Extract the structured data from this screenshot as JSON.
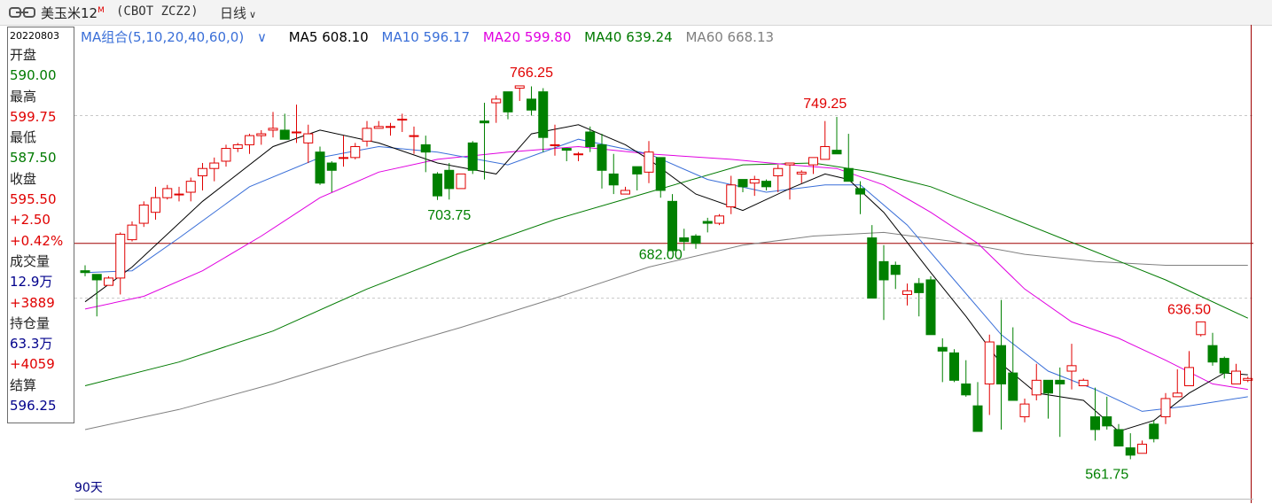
{
  "header": {
    "instrument_name": "美玉米12",
    "main_contract_mark": "M",
    "code": "(CBOT ZCZ2)",
    "period": "日线"
  },
  "info_panel": {
    "date": "20220803",
    "open_label": "开盘",
    "open": "590.00",
    "high_label": "最高",
    "high": "599.75",
    "low_label": "最低",
    "low": "587.50",
    "close_label": "收盘",
    "close": "595.50",
    "change": "+2.50",
    "change_pct": "+0.42%",
    "volume_label": "成交量",
    "volume": "12.9万",
    "volume_change": "+3889",
    "oi_label": "持仓量",
    "oi": "63.3万",
    "oi_change": "+4059",
    "settle_label": "结算",
    "settle": "596.25"
  },
  "legend": {
    "combo": "MA组合(5,10,20,40,60,0)",
    "ma5": "MA5 608.10",
    "ma10": "MA10 596.17",
    "ma20": "MA20 599.80",
    "ma40": "MA40 639.24",
    "ma60": "MA60 668.13"
  },
  "footer": {
    "days": "90天"
  },
  "colors": {
    "up": "#e00000",
    "down": "#008000",
    "ma5": "#000000",
    "ma10": "#3a6fd8",
    "ma20": "#e000e0",
    "ma40": "#007a00",
    "ma60": "#808080",
    "crosshair": "#a00000"
  },
  "chart_data": {
    "type": "candlestick",
    "ylim": [
      545,
      790
    ],
    "crosshair_price": 680,
    "annotations": [
      {
        "label": "766.25",
        "candle": 38,
        "price": 766.25,
        "kind": "high"
      },
      {
        "label": "703.75",
        "candle": 31,
        "price": 703.75,
        "kind": "low"
      },
      {
        "label": "749.25",
        "candle": 63,
        "price": 749.25,
        "kind": "high"
      },
      {
        "label": "682.00",
        "candle": 49,
        "price": 682.0,
        "kind": "low"
      },
      {
        "label": "561.75",
        "candle": 87,
        "price": 561.75,
        "kind": "low"
      },
      {
        "label": "636.50",
        "candle": 94,
        "price": 636.5,
        "kind": "high"
      }
    ],
    "candles": [
      [
        665,
        664,
        668,
        662
      ],
      [
        663,
        660,
        662,
        640
      ],
      [
        657,
        661,
        662,
        657
      ],
      [
        661,
        685,
        686,
        652
      ],
      [
        682,
        690,
        692,
        681
      ],
      [
        691,
        701,
        703,
        689
      ],
      [
        697,
        705,
        711,
        693
      ],
      [
        705,
        710,
        712,
        704
      ],
      [
        707,
        707,
        711,
        703
      ],
      [
        708,
        714,
        716,
        703
      ],
      [
        717,
        721,
        724,
        709
      ],
      [
        721,
        724,
        727,
        714
      ],
      [
        725,
        732,
        734,
        722
      ],
      [
        732,
        734,
        735,
        730
      ],
      [
        734,
        739,
        740,
        729
      ],
      [
        739,
        740,
        742,
        734
      ],
      [
        742,
        743,
        752,
        738
      ],
      [
        742,
        737,
        751,
        737
      ],
      [
        741,
        741,
        756,
        735
      ],
      [
        735,
        740,
        745,
        724
      ],
      [
        730,
        713,
        733,
        712
      ],
      [
        724,
        720,
        725,
        708
      ],
      [
        727,
        727,
        739,
        722
      ],
      [
        727,
        733,
        735,
        726
      ],
      [
        736,
        743,
        747,
        733
      ],
      [
        743,
        744,
        747,
        743
      ],
      [
        744,
        744,
        746,
        739
      ],
      [
        748,
        748,
        751,
        741
      ],
      [
        739,
        739,
        744,
        729
      ],
      [
        734,
        730,
        739,
        719
      ],
      [
        718,
        706,
        719,
        703.75
      ],
      [
        720,
        710,
        724,
        704
      ],
      [
        710,
        718,
        718,
        710
      ],
      [
        735,
        720,
        736,
        718
      ],
      [
        747,
        746,
        757,
        715
      ],
      [
        757,
        759,
        761,
        746
      ],
      [
        763,
        752,
        763,
        748
      ],
      [
        765,
        766.25,
        766.25,
        758
      ],
      [
        759,
        753,
        766,
        750
      ],
      [
        763,
        738,
        765,
        730
      ],
      [
        734,
        734,
        745,
        728
      ],
      [
        732,
        731,
        732,
        725
      ],
      [
        729,
        729,
        730,
        725
      ],
      [
        741,
        733,
        744,
        730
      ],
      [
        734,
        720,
        740,
        710
      ],
      [
        718,
        712,
        729,
        707
      ],
      [
        707,
        709,
        711,
        707
      ],
      [
        722,
        718,
        722,
        709
      ],
      [
        719,
        730,
        736,
        713
      ],
      [
        727,
        709,
        727,
        705
      ],
      [
        703,
        676,
        707,
        682
      ],
      [
        683,
        681,
        688,
        676
      ],
      [
        684,
        680,
        685,
        677
      ],
      [
        692,
        691,
        694,
        686
      ],
      [
        691,
        695,
        696,
        690
      ],
      [
        700,
        712,
        717,
        696
      ],
      [
        715,
        711,
        714,
        708
      ],
      [
        713,
        715,
        717,
        706
      ],
      [
        714,
        711,
        715,
        709
      ],
      [
        717,
        721,
        723,
        708
      ],
      [
        723,
        724,
        724,
        704
      ],
      [
        718,
        719,
        720,
        713
      ],
      [
        723,
        727,
        727,
        718
      ],
      [
        726,
        733,
        747,
        733
      ],
      [
        731,
        729,
        749.25,
        729
      ],
      [
        721,
        714,
        740,
        719
      ],
      [
        710,
        707,
        714,
        696
      ],
      [
        683,
        650,
        690,
        655
      ],
      [
        670,
        660,
        679,
        638
      ],
      [
        668,
        663,
        670,
        655
      ],
      [
        652,
        654,
        658,
        646
      ],
      [
        658,
        653,
        661,
        640
      ],
      [
        660,
        630,
        662,
        630
      ],
      [
        623,
        621,
        628,
        604
      ],
      [
        620,
        605,
        622,
        604
      ],
      [
        603,
        597,
        616,
        596
      ],
      [
        591,
        577,
        604,
        577
      ],
      [
        603,
        626,
        630,
        586
      ],
      [
        624,
        603,
        649,
        578
      ],
      [
        609,
        594,
        634,
        595
      ],
      [
        585,
        592,
        595,
        582
      ],
      [
        597,
        605,
        614,
        594
      ],
      [
        605,
        598,
        605,
        584
      ],
      [
        605,
        603,
        612,
        574
      ],
      [
        610,
        613,
        625,
        600
      ],
      [
        602,
        605,
        606,
        604
      ],
      [
        585,
        578,
        601,
        572
      ],
      [
        585,
        580,
        596,
        578
      ],
      [
        578,
        569,
        581,
        570
      ],
      [
        568,
        564,
        576,
        561.75
      ],
      [
        565,
        570,
        572,
        566
      ],
      [
        581,
        573,
        583,
        571
      ],
      [
        585,
        595,
        598,
        581
      ],
      [
        596,
        598,
        611,
        597
      ],
      [
        602,
        612,
        621,
        602
      ],
      [
        630,
        637,
        636.5,
        629
      ],
      [
        624,
        615,
        631,
        613
      ],
      [
        617,
        609,
        618,
        606
      ],
      [
        603,
        610,
        614,
        603
      ],
      [
        605,
        606,
        607,
        604
      ]
    ],
    "ma5": [
      [
        0,
        648
      ],
      [
        4,
        667
      ],
      [
        10,
        703
      ],
      [
        16,
        733
      ],
      [
        20,
        742
      ],
      [
        25,
        735
      ],
      [
        30,
        724
      ],
      [
        35,
        718
      ],
      [
        38,
        740
      ],
      [
        42,
        745
      ],
      [
        46,
        734
      ],
      [
        48,
        726
      ],
      [
        52,
        707
      ],
      [
        56,
        698
      ],
      [
        60,
        710
      ],
      [
        63,
        718
      ],
      [
        65,
        715
      ],
      [
        68,
        697
      ],
      [
        72,
        664
      ],
      [
        75,
        640
      ],
      [
        78,
        614
      ],
      [
        81,
        598
      ],
      [
        85,
        594
      ],
      [
        88,
        577
      ],
      [
        91,
        583
      ],
      [
        94,
        598
      ],
      [
        97,
        609
      ],
      [
        99,
        608
      ]
    ],
    "ma10": [
      [
        0,
        664
      ],
      [
        4,
        665
      ],
      [
        8,
        683
      ],
      [
        14,
        711
      ],
      [
        20,
        727
      ],
      [
        25,
        733
      ],
      [
        30,
        730
      ],
      [
        36,
        723
      ],
      [
        42,
        737
      ],
      [
        48,
        729
      ],
      [
        53,
        715
      ],
      [
        58,
        708
      ],
      [
        63,
        712
      ],
      [
        66,
        712
      ],
      [
        70,
        690
      ],
      [
        74,
        660
      ],
      [
        78,
        630
      ],
      [
        82,
        610
      ],
      [
        86,
        600
      ],
      [
        90,
        588
      ],
      [
        94,
        591
      ],
      [
        99,
        596
      ]
    ],
    "ma20": [
      [
        0,
        644
      ],
      [
        5,
        651
      ],
      [
        10,
        665
      ],
      [
        15,
        684
      ],
      [
        20,
        705
      ],
      [
        25,
        719
      ],
      [
        30,
        726
      ],
      [
        36,
        730
      ],
      [
        42,
        733
      ],
      [
        48,
        729
      ],
      [
        55,
        726
      ],
      [
        60,
        723
      ],
      [
        64,
        721
      ],
      [
        68,
        712
      ],
      [
        72,
        697
      ],
      [
        76,
        680
      ],
      [
        80,
        655
      ],
      [
        84,
        637
      ],
      [
        88,
        628
      ],
      [
        92,
        616
      ],
      [
        96,
        603
      ],
      [
        99,
        600
      ]
    ],
    "ma40": [
      [
        0,
        602
      ],
      [
        8,
        615
      ],
      [
        16,
        632
      ],
      [
        24,
        655
      ],
      [
        32,
        675
      ],
      [
        40,
        693
      ],
      [
        48,
        708
      ],
      [
        56,
        723
      ],
      [
        62,
        724
      ],
      [
        67,
        719
      ],
      [
        72,
        711
      ],
      [
        78,
        696
      ],
      [
        85,
        678
      ],
      [
        92,
        660
      ],
      [
        99,
        639
      ]
    ],
    "ma60": [
      [
        0,
        578
      ],
      [
        8,
        589
      ],
      [
        16,
        603
      ],
      [
        24,
        619
      ],
      [
        32,
        634
      ],
      [
        40,
        650
      ],
      [
        48,
        667
      ],
      [
        56,
        679
      ],
      [
        62,
        684
      ],
      [
        68,
        686
      ],
      [
        74,
        681
      ],
      [
        80,
        674
      ],
      [
        86,
        670
      ],
      [
        92,
        668
      ],
      [
        99,
        668
      ]
    ]
  }
}
